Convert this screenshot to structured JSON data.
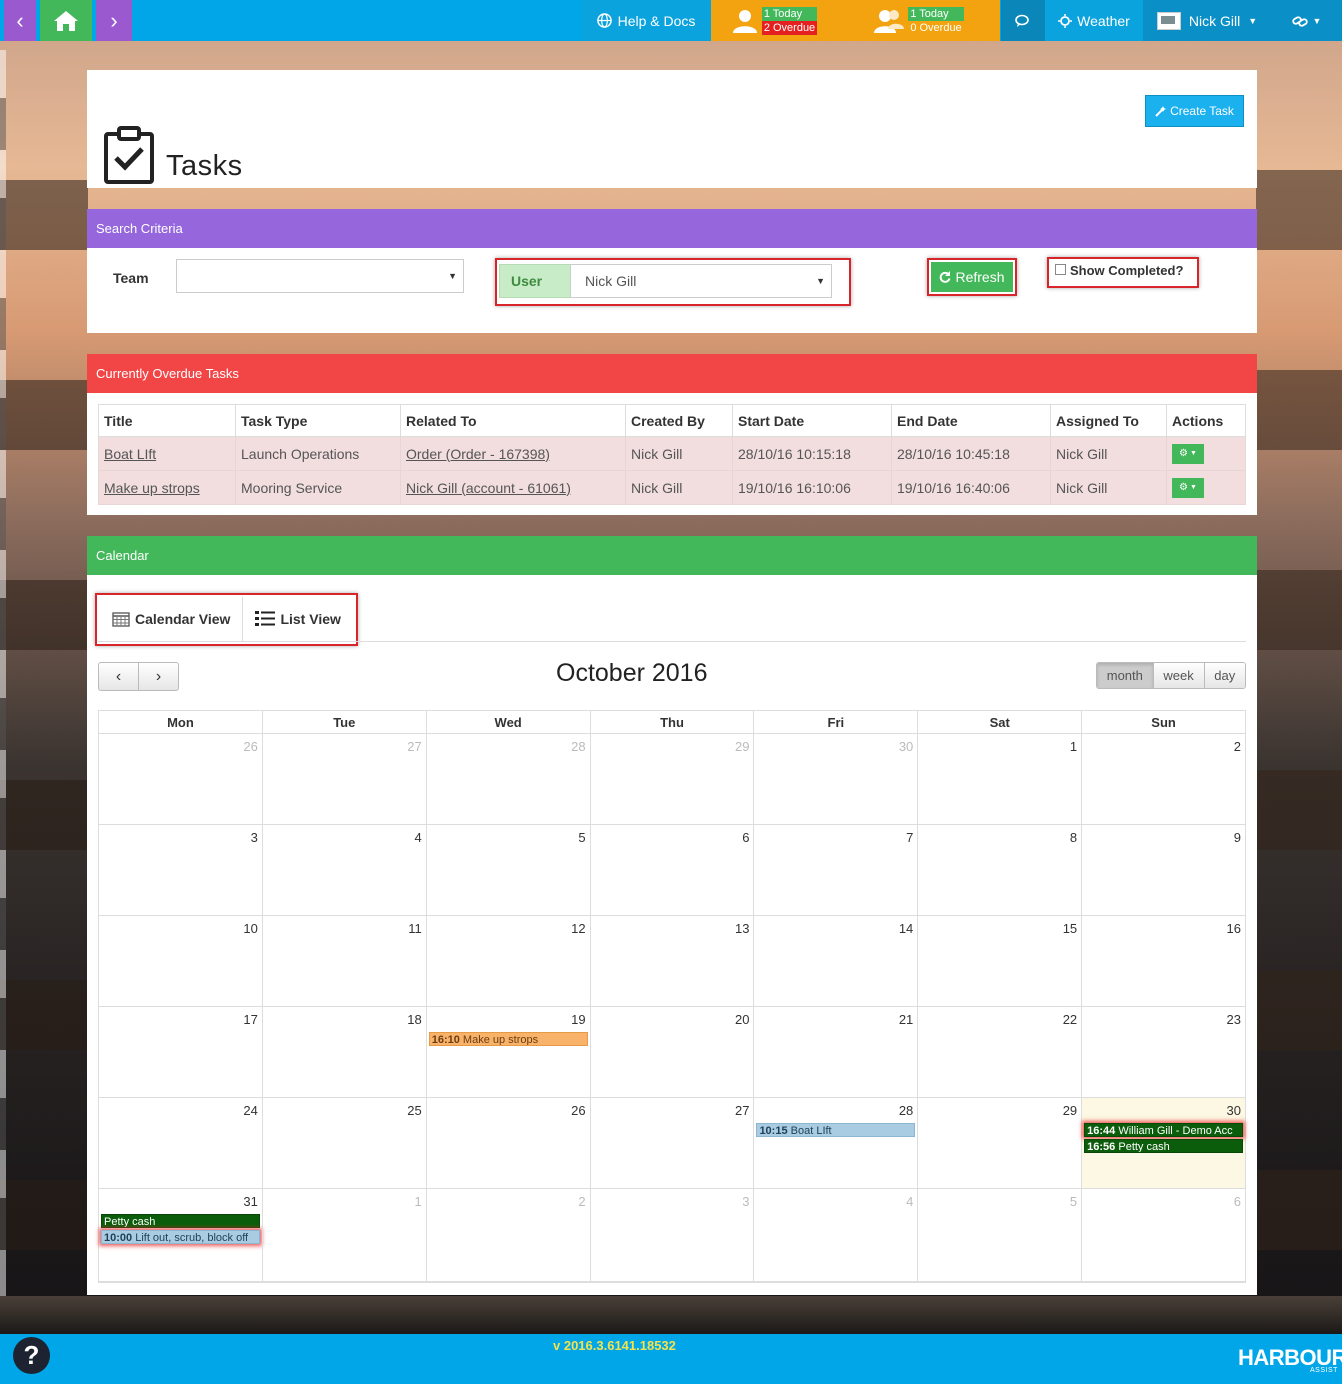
{
  "nav": {
    "help_label": "Help & Docs",
    "user_tasks": {
      "today": "1 Today",
      "overdue": "2 Overdue"
    },
    "team_tasks": {
      "today": "1 Today",
      "overdue": "0 Overdue"
    },
    "weather_label": "Weather",
    "profile_name": "Nick Gill"
  },
  "header": {
    "create_task_label": "Create Task",
    "page_title": "Tasks"
  },
  "search": {
    "section_title": "Search Criteria",
    "team_label": "Team",
    "team_value": "",
    "user_label": "User",
    "user_value": "Nick Gill",
    "refresh_label": "Refresh",
    "show_completed_label": "Show Completed?",
    "show_completed": false
  },
  "overdue": {
    "section_title": "Currently Overdue Tasks",
    "columns": [
      "Title",
      "Task Type",
      "Related To",
      "Created By",
      "Start Date",
      "End Date",
      "Assigned To",
      "Actions"
    ],
    "rows": [
      {
        "title": "Boat LIft",
        "task_type": "Launch Operations",
        "related_to": "Order (Order - 167398)",
        "created_by": "Nick Gill",
        "start_date": "28/10/16 10:15:18",
        "end_date": "28/10/16 10:45:18",
        "assigned_to": "Nick Gill"
      },
      {
        "title": "Make up strops",
        "task_type": "Mooring Service",
        "related_to": "Nick Gill (account - 61061)",
        "created_by": "Nick Gill",
        "start_date": "19/10/16 16:10:06",
        "end_date": "19/10/16 16:40:06",
        "assigned_to": "Nick Gill"
      }
    ]
  },
  "calendar": {
    "section_title": "Calendar",
    "calendar_view_label": "Calendar View",
    "list_view_label": "List View",
    "title": "October 2016",
    "range_buttons": [
      "month",
      "week",
      "day"
    ],
    "active_range": "month",
    "weekdays": [
      "Mon",
      "Tue",
      "Wed",
      "Thu",
      "Fri",
      "Sat",
      "Sun"
    ],
    "weeks": [
      [
        {
          "d": "26",
          "other": true
        },
        {
          "d": "27",
          "other": true
        },
        {
          "d": "28",
          "other": true
        },
        {
          "d": "29",
          "other": true
        },
        {
          "d": "30",
          "other": true
        },
        {
          "d": "1"
        },
        {
          "d": "2"
        }
      ],
      [
        {
          "d": "3"
        },
        {
          "d": "4"
        },
        {
          "d": "5"
        },
        {
          "d": "6"
        },
        {
          "d": "7"
        },
        {
          "d": "8"
        },
        {
          "d": "9"
        }
      ],
      [
        {
          "d": "10"
        },
        {
          "d": "11"
        },
        {
          "d": "12"
        },
        {
          "d": "13"
        },
        {
          "d": "14"
        },
        {
          "d": "15"
        },
        {
          "d": "16"
        }
      ],
      [
        {
          "d": "17"
        },
        {
          "d": "18"
        },
        {
          "d": "19",
          "events": [
            {
              "time": "16:10",
              "title": "Make up strops",
              "style": "orange"
            }
          ]
        },
        {
          "d": "20"
        },
        {
          "d": "21"
        },
        {
          "d": "22"
        },
        {
          "d": "23"
        }
      ],
      [
        {
          "d": "24"
        },
        {
          "d": "25"
        },
        {
          "d": "26"
        },
        {
          "d": "27"
        },
        {
          "d": "28",
          "events": [
            {
              "time": "10:15",
              "title": "Boat LIft",
              "style": "blue"
            }
          ]
        },
        {
          "d": "29"
        },
        {
          "d": "30",
          "today": true,
          "events": [
            {
              "time": "16:44",
              "title": "William Gill - Demo Acc",
              "style": "dark",
              "glow": true
            },
            {
              "time": "16:56",
              "title": "Petty cash",
              "style": "dark"
            }
          ]
        }
      ],
      [
        {
          "d": "31",
          "events": [
            {
              "time": "",
              "title": "Petty cash",
              "style": "dark"
            },
            {
              "time": "10:00",
              "title": "Lift out, scrub, block off",
              "style": "blue",
              "glow": true
            }
          ]
        },
        {
          "d": "1",
          "other": true
        },
        {
          "d": "2",
          "other": true
        },
        {
          "d": "3",
          "other": true
        },
        {
          "d": "4",
          "other": true
        },
        {
          "d": "5",
          "other": true
        },
        {
          "d": "6",
          "other": true
        }
      ]
    ]
  },
  "footer": {
    "version": "v 2016.3.6141.18532",
    "brand": "HARBOUR",
    "brand_sub": "ASSIST"
  }
}
